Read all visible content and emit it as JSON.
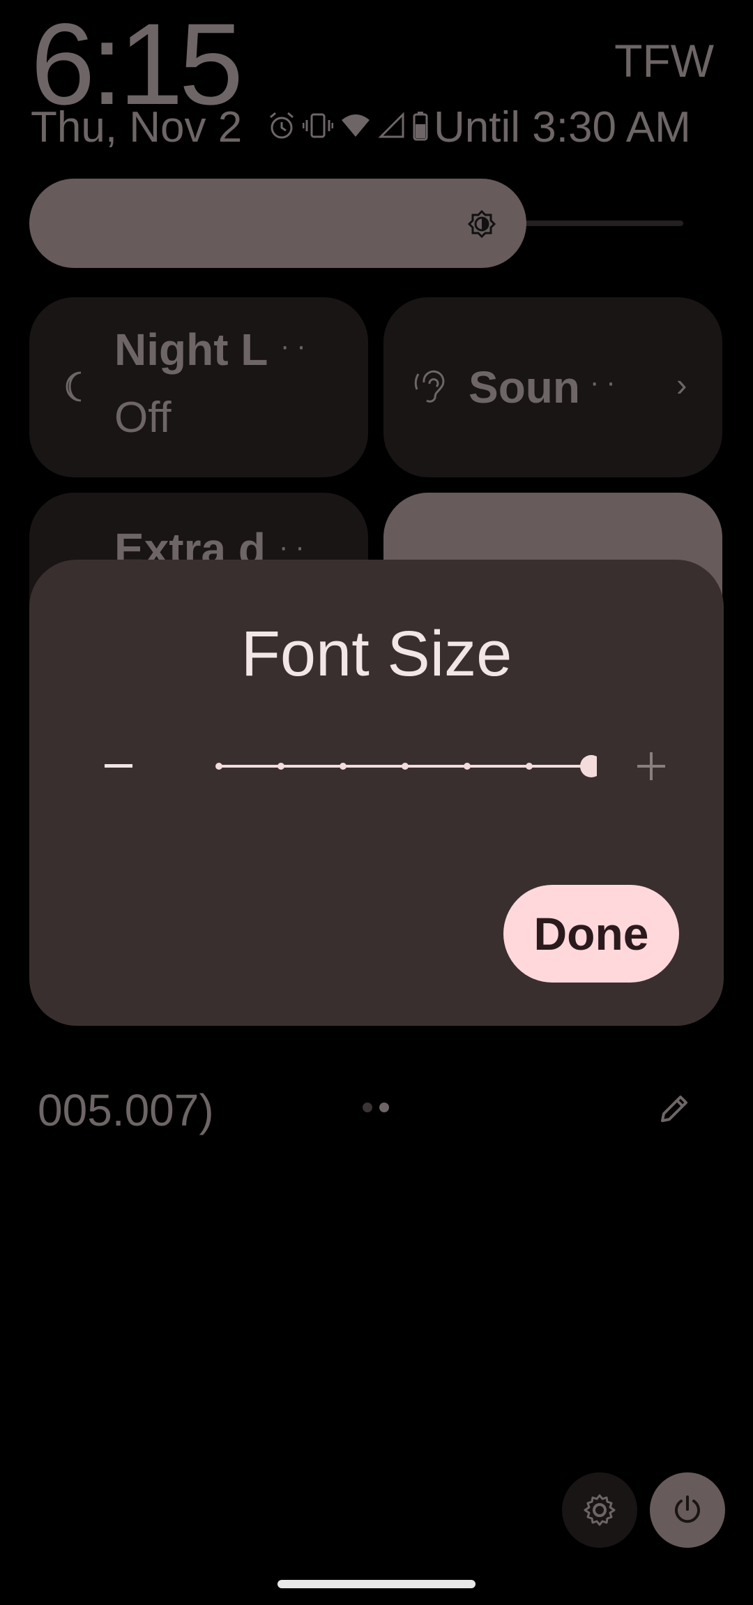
{
  "status": {
    "time": "6:15",
    "carrier": "TFW",
    "date": "Thu, Nov 2",
    "battery_text": "Until 3:30 AM",
    "icons": [
      "alarm-icon",
      "vibrate-icon",
      "wifi-icon",
      "signal-icon",
      "battery-icon"
    ]
  },
  "brightness": {
    "level": 0.72,
    "icon": "brightness-icon"
  },
  "tiles": [
    {
      "label": "Night L",
      "sub": "Off",
      "icon": "moon-icon",
      "active": false
    },
    {
      "label": "Soun",
      "icon": "hearing-icon",
      "active": false,
      "has_chevron": true
    },
    {
      "label": "Extra d",
      "icon": "extra-dim-icon",
      "active": false
    },
    {
      "label": "",
      "active": true
    }
  ],
  "dialog": {
    "title": "Font Size",
    "decrease_icon": "minus-icon",
    "increase_icon": "plus-icon",
    "slider": {
      "steps": 7,
      "value_index": 6
    },
    "done_label": "Done"
  },
  "footer": {
    "build_text": "005.007)",
    "page_count": 2,
    "edit_icon": "pencil-icon"
  },
  "bottom": {
    "settings_icon": "gear-icon",
    "power_icon": "power-icon"
  },
  "colors": {
    "accent": "#ffd8dc",
    "dialog_bg": "#3a2f2f",
    "tile_bg": "#191515",
    "tile_active": "#675b5b"
  }
}
